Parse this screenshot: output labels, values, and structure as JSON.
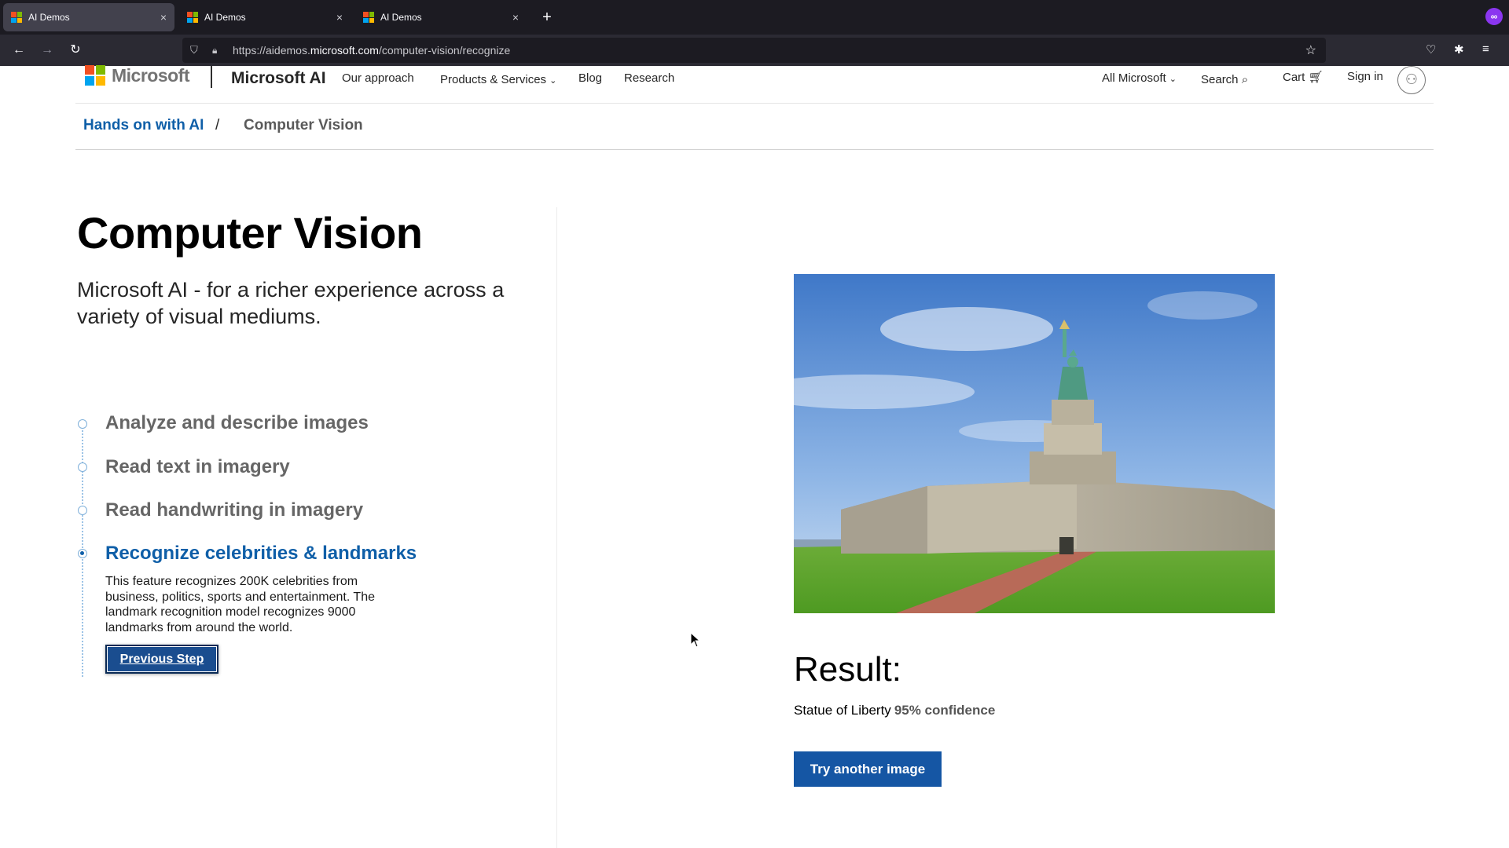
{
  "browser": {
    "tabs": [
      {
        "title": "AI Demos",
        "active": true
      },
      {
        "title": "AI Demos",
        "active": false
      },
      {
        "title": "AI Demos",
        "active": false
      }
    ],
    "close_glyph": "×",
    "new_tab_glyph": "+",
    "url_prefix": "https://aidemos.",
    "url_domain": "microsoft.com",
    "url_path": "/computer-vision/recognize"
  },
  "header": {
    "logo_text": "Microsoft",
    "brand": "Microsoft AI",
    "nav": [
      "Our approach",
      "Products & Services",
      "Blog",
      "Research"
    ],
    "all_microsoft": "All Microsoft",
    "search": "Search",
    "cart": "Cart",
    "sign_in": "Sign in"
  },
  "breadcrumb": {
    "parent": "Hands on with AI",
    "separator": "/",
    "current": "Computer Vision"
  },
  "main": {
    "title": "Computer Vision",
    "subtitle": "Microsoft AI - for a richer experience across a variety of visual mediums.",
    "steps": [
      {
        "label": "Analyze and describe images",
        "active": false
      },
      {
        "label": "Read text in imagery",
        "active": false
      },
      {
        "label": "Read handwriting in imagery",
        "active": false
      },
      {
        "label": "Recognize celebrities & landmarks",
        "active": true
      }
    ],
    "active_step_description": "This feature recognizes 200K celebrities from business, politics, sports and entertainment. The landmark recognition model recognizes 9000 landmarks from around the world.",
    "previous_button": "Previous Step"
  },
  "result": {
    "heading": "Result:",
    "label": "Statue of Liberty",
    "confidence": "95% confidence",
    "try_button": "Try another image"
  },
  "colors": {
    "accent": "#0f5fa8",
    "button": "#1556a4",
    "tab_bar": "#1c1b22",
    "toolbar": "#2b2a33"
  }
}
